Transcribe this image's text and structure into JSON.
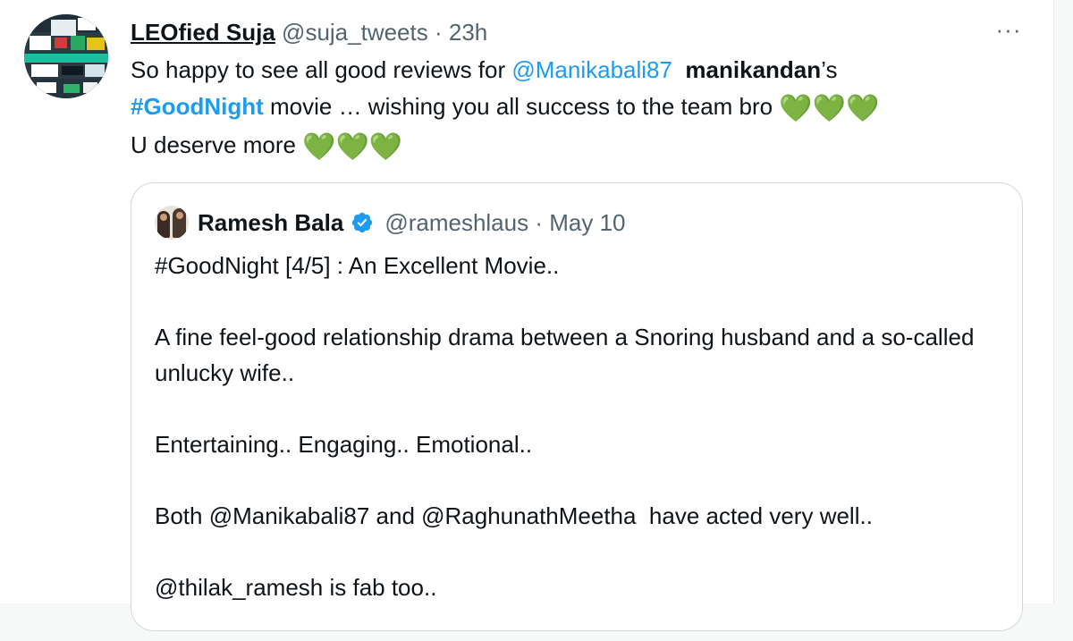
{
  "tweet": {
    "display_name": "LEOfied Suja",
    "handle": "@suja_tweets",
    "separator": "·",
    "time": "23h",
    "more_label": "···",
    "body": {
      "part1": "So happy to see all good reviews for ",
      "mention": "@Manikabali87",
      "part2": "  ",
      "bold_name": "manikandan",
      "part3": "’s",
      "hashtag": "#GoodNight",
      "part4": " movie … wishing you all success to the team bro ",
      "line3": "U deserve more ",
      "hearts": "💚💚💚"
    }
  },
  "quote": {
    "display_name": "Ramesh Bala",
    "handle": "@rameshlaus",
    "separator": "·",
    "date": "May 10",
    "paragraphs": [
      "#GoodNight [4/5] : An Excellent Movie..",
      "A fine feel-good relationship drama between a Snoring husband and a so-called unlucky wife..",
      "Entertaining.. Engaging.. Emotional..",
      "Both @Manikabali87 and @RaghunathMeetha  have acted very well..",
      "@thilak_ramesh is fab too.."
    ]
  },
  "colors": {
    "accent": "#1d9bf0",
    "secondary_text": "#536471",
    "heart": "#5fac3b"
  }
}
